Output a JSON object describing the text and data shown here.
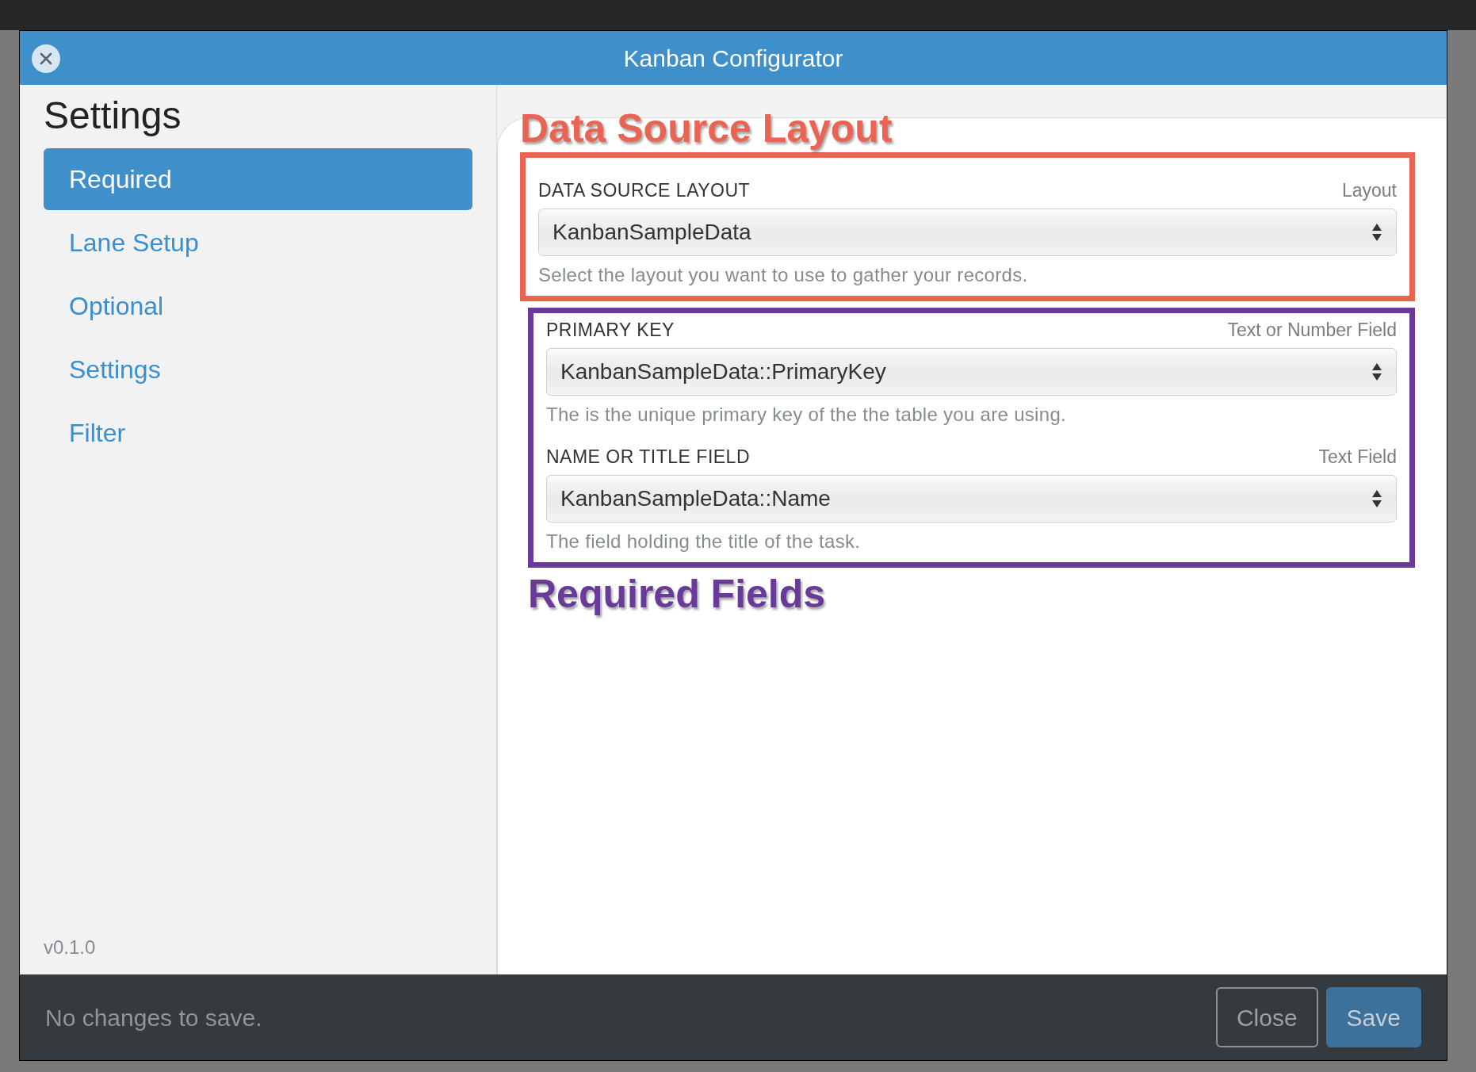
{
  "window": {
    "title": "Kanban Configurator"
  },
  "sidebar": {
    "title": "Settings",
    "items": [
      {
        "label": "Required",
        "selected": true
      },
      {
        "label": "Lane Setup",
        "selected": false
      },
      {
        "label": "Optional",
        "selected": false
      },
      {
        "label": "Settings",
        "selected": false
      },
      {
        "label": "Filter",
        "selected": false
      }
    ],
    "version": "v0.1.0"
  },
  "sections": [
    {
      "annotation": "Data Source Layout",
      "kind": "above",
      "color": "#ea6454",
      "fields": [
        {
          "label": "DATA SOURCE LAYOUT",
          "type_hint": "Layout",
          "value": "KanbanSampleData",
          "help": "Select the layout you want to use to gather your records."
        }
      ]
    },
    {
      "annotation": "Required Fields",
      "kind": "below",
      "color": "#6a3a98",
      "fields": [
        {
          "label": "PRIMARY KEY",
          "type_hint": "Text or Number Field",
          "value": "KanbanSampleData::PrimaryKey",
          "help": "The is the unique primary key of the the table you are using."
        },
        {
          "label": "NAME OR TITLE FIELD",
          "type_hint": "Text Field",
          "value": "KanbanSampleData::Name",
          "help": "The field holding the title of the task."
        }
      ]
    }
  ],
  "footer": {
    "status": "No changes to save.",
    "buttons": [
      {
        "label": "Close",
        "kind": "outline"
      },
      {
        "label": "Save",
        "kind": "primary"
      }
    ]
  }
}
